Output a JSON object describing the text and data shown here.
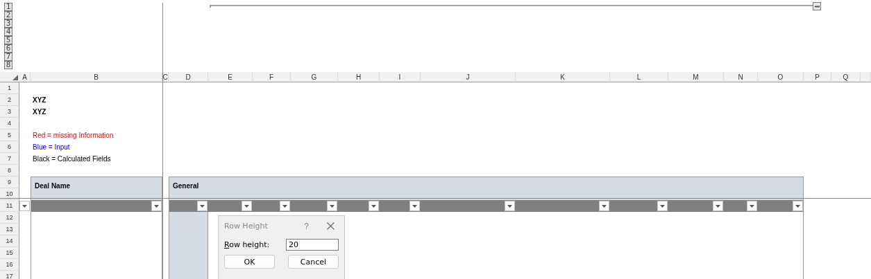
{
  "outline": {
    "levels": [
      "1",
      "2",
      "3",
      "4",
      "5",
      "6",
      "7",
      "8"
    ],
    "group_expanded": true
  },
  "columns": [
    {
      "label": "A",
      "filter": true
    },
    {
      "label": "B",
      "filter": true
    },
    {
      "label": "C",
      "filter": false
    },
    {
      "label": "D",
      "filter": true
    },
    {
      "label": "E",
      "filter": true
    },
    {
      "label": "F",
      "filter": true
    },
    {
      "label": "G",
      "filter": true
    },
    {
      "label": "H",
      "filter": true
    },
    {
      "label": "I",
      "filter": true
    },
    {
      "label": "J",
      "filter": true
    },
    {
      "label": "K",
      "filter": true
    },
    {
      "label": "L",
      "filter": true
    },
    {
      "label": "M",
      "filter": true
    },
    {
      "label": "N",
      "filter": true
    },
    {
      "label": "O",
      "filter": true
    },
    {
      "label": "P",
      "filter": false
    },
    {
      "label": "Q",
      "filter": false
    }
  ],
  "rows": [
    {
      "number": "1"
    },
    {
      "number": "2",
      "text": "XYZ",
      "bold": true
    },
    {
      "number": "3",
      "text": "XYZ",
      "bold": true
    },
    {
      "number": "4"
    },
    {
      "number": "5",
      "text": "Red = missing Information",
      "color": "#ff0000"
    },
    {
      "number": "6",
      "text": "Blue = Input",
      "color": "#0000ff"
    },
    {
      "number": "7",
      "text": "Black = Calculated Fields",
      "color": "#000000"
    },
    {
      "number": "8"
    },
    {
      "number": "9"
    },
    {
      "number": "10"
    },
    {
      "number": "11"
    },
    {
      "number": "12"
    },
    {
      "number": "13"
    },
    {
      "number": "14"
    },
    {
      "number": "15"
    },
    {
      "number": "16"
    },
    {
      "number": "17"
    }
  ],
  "tables": [
    {
      "title": "Deal Name"
    },
    {
      "title": "General"
    }
  ],
  "dialog": {
    "title": "Row Height",
    "help": "?",
    "label": "Row height:",
    "value": "20",
    "buttons": [
      "OK",
      "Cancel"
    ]
  }
}
